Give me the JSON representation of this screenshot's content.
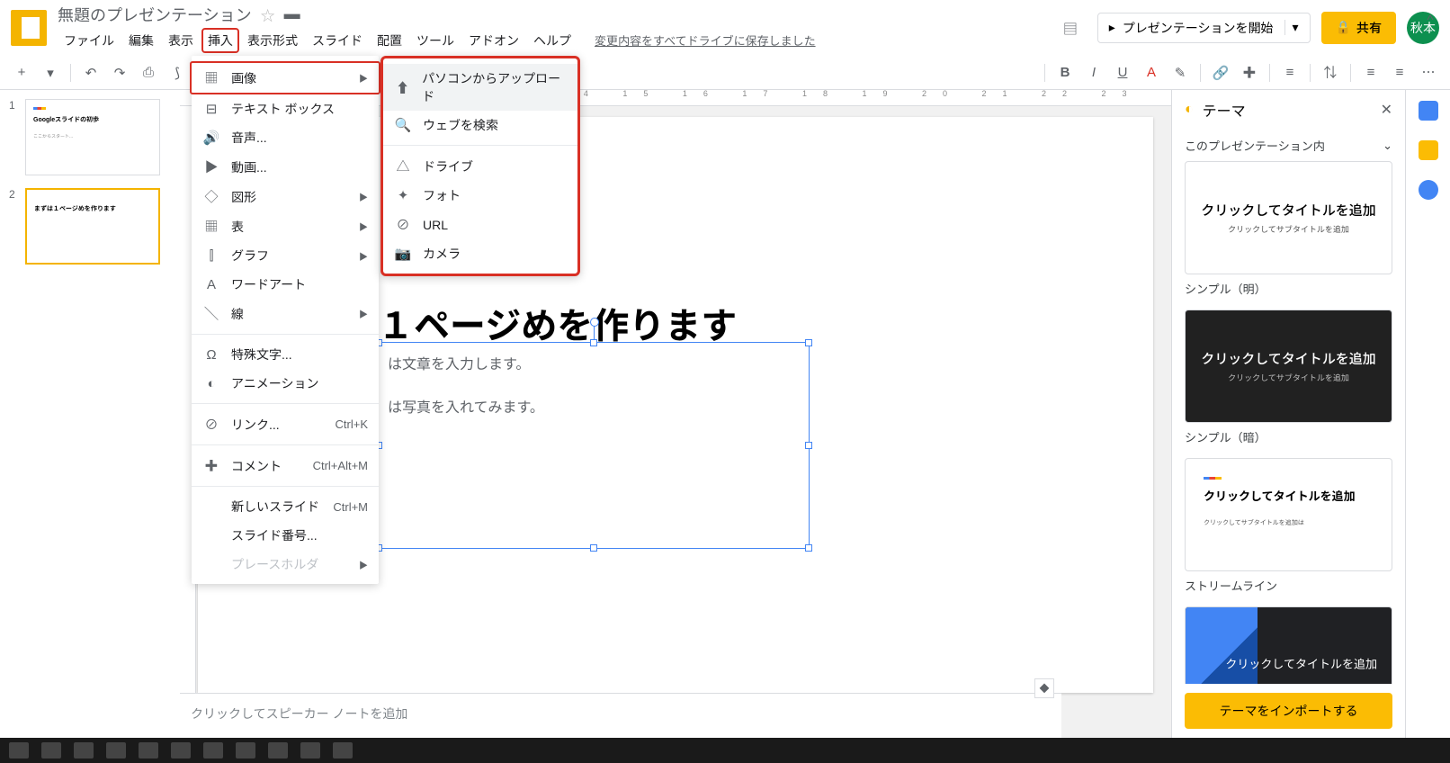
{
  "doc": {
    "title": "無題のプレゼンテーション"
  },
  "menubar": [
    "ファイル",
    "編集",
    "表示",
    "挿入",
    "表示形式",
    "スライド",
    "配置",
    "ツール",
    "アドオン",
    "ヘルプ"
  ],
  "save_status": "変更内容をすべてドライブに保存しました",
  "header": {
    "present": "プレゼンテーションを開始",
    "share": "共有",
    "avatar": "秋本"
  },
  "insert_menu": {
    "items": [
      {
        "ic": "▦",
        "label": "画像",
        "arrow": true
      },
      {
        "ic": "⊟",
        "label": "テキスト ボックス"
      },
      {
        "ic": "🔊",
        "label": "音声..."
      },
      {
        "ic": "▶",
        "label": "動画..."
      },
      {
        "ic": "◇",
        "label": "図形",
        "arrow": true
      },
      {
        "ic": "▦",
        "label": "表",
        "arrow": true
      },
      {
        "ic": "⫿",
        "label": "グラフ",
        "arrow": true
      },
      {
        "ic": "A",
        "label": "ワードアート"
      },
      {
        "ic": "╲",
        "label": "線",
        "arrow": true
      },
      {
        "sep": true
      },
      {
        "ic": "Ω",
        "label": "特殊文字..."
      },
      {
        "ic": "◐",
        "label": "アニメーション"
      },
      {
        "sep": true
      },
      {
        "ic": "⊘",
        "label": "リンク...",
        "shortcut": "Ctrl+K"
      },
      {
        "sep": true
      },
      {
        "ic": "✚",
        "label": "コメント",
        "shortcut": "Ctrl+Alt+M"
      },
      {
        "sep": true
      },
      {
        "ic": "",
        "label": "新しいスライド",
        "shortcut": "Ctrl+M"
      },
      {
        "ic": "",
        "label": "スライド番号..."
      },
      {
        "ic": "",
        "label": "プレースホルダ",
        "arrow": true,
        "disabled": true
      }
    ]
  },
  "sub_menu": {
    "items": [
      {
        "ic": "⬆",
        "label": "パソコンからアップロード",
        "hover": true
      },
      {
        "ic": "🔍",
        "label": "ウェブを検索"
      },
      {
        "sep": true
      },
      {
        "ic": "△",
        "label": "ドライブ"
      },
      {
        "ic": "✦",
        "label": "フォト"
      },
      {
        "ic": "⊘",
        "label": "URL"
      },
      {
        "ic": "📷",
        "label": "カメラ"
      }
    ]
  },
  "slide": {
    "title": "１ページめを作ります",
    "body1": "は文章を入力します。",
    "body2": "は写真を入れてみます。"
  },
  "thumbs": [
    {
      "num": "1",
      "title": "Googleスライドの初歩",
      "sub": "ここからスタート..."
    },
    {
      "num": "2",
      "title": "まずは１ページめを作ります",
      "sel": true
    }
  ],
  "speaker": "クリックしてスピーカー ノートを追加",
  "themes": {
    "panel_title": "テーマ",
    "section": "このプレゼンテーション内",
    "list": [
      {
        "title": "クリックしてタイトルを追加",
        "sub": "クリックしてサブタイトルを追加",
        "name": "シンプル（明）",
        "cls": ""
      },
      {
        "title": "クリックしてタイトルを追加",
        "sub": "クリックしてサブタイトルを追加",
        "name": "シンプル（暗）",
        "cls": "dark"
      },
      {
        "title": "クリックしてタイトルを追加",
        "sub": "クリックしてサブタイトルを追加は",
        "name": "ストリームライン",
        "cls": "stream"
      },
      {
        "title": "クリックしてタイトルを追加",
        "sub": "",
        "name": "",
        "cls": "focus"
      }
    ],
    "import": "テーマをインポートする"
  },
  "ruler": "7  8  9  10  11  12  13  14  15  16  17  18  19  20  21  22  23  24  "
}
